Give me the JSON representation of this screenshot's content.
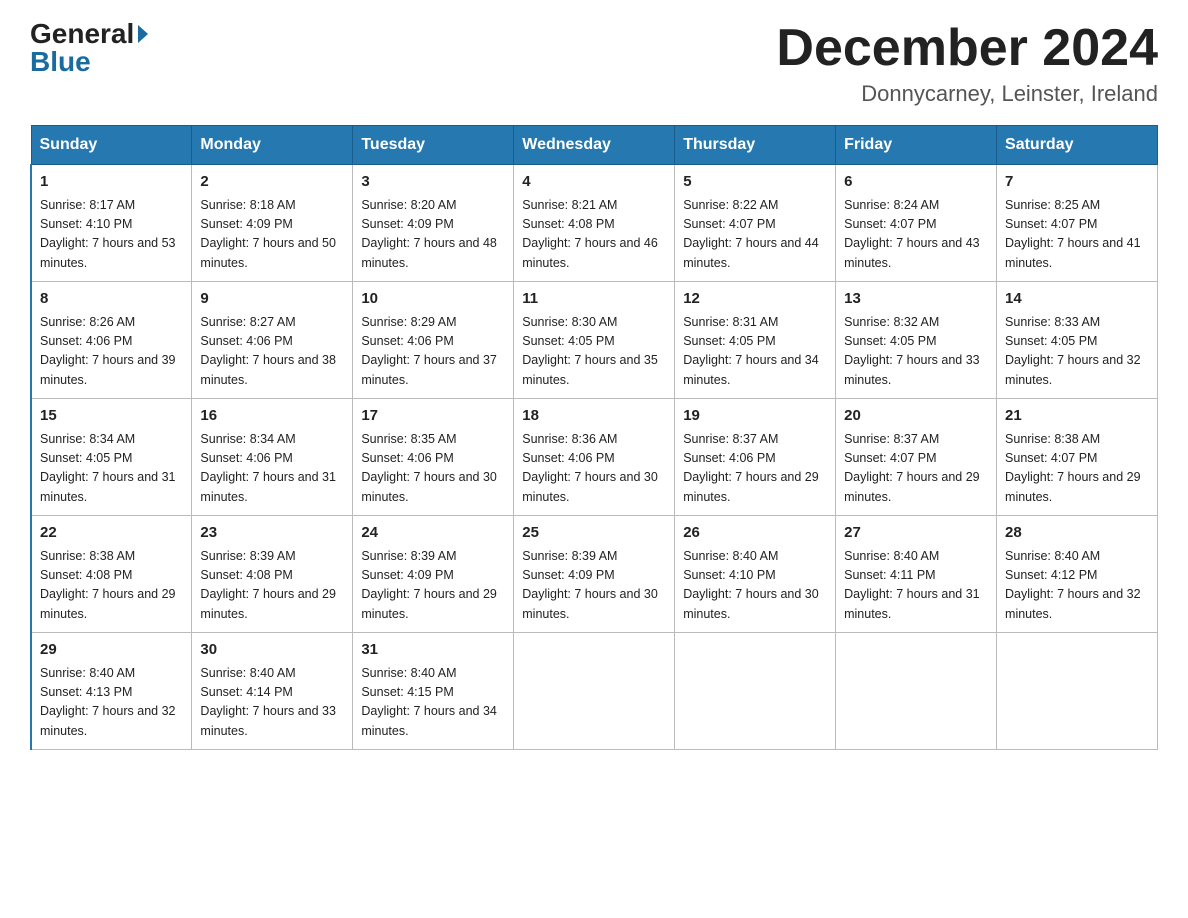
{
  "header": {
    "logo_general": "General",
    "logo_blue": "Blue",
    "month_title": "December 2024",
    "location": "Donnycarney, Leinster, Ireland"
  },
  "weekdays": [
    "Sunday",
    "Monday",
    "Tuesday",
    "Wednesday",
    "Thursday",
    "Friday",
    "Saturday"
  ],
  "weeks": [
    [
      {
        "day": "1",
        "sunrise": "8:17 AM",
        "sunset": "4:10 PM",
        "daylight": "7 hours and 53 minutes."
      },
      {
        "day": "2",
        "sunrise": "8:18 AM",
        "sunset": "4:09 PM",
        "daylight": "7 hours and 50 minutes."
      },
      {
        "day": "3",
        "sunrise": "8:20 AM",
        "sunset": "4:09 PM",
        "daylight": "7 hours and 48 minutes."
      },
      {
        "day": "4",
        "sunrise": "8:21 AM",
        "sunset": "4:08 PM",
        "daylight": "7 hours and 46 minutes."
      },
      {
        "day": "5",
        "sunrise": "8:22 AM",
        "sunset": "4:07 PM",
        "daylight": "7 hours and 44 minutes."
      },
      {
        "day": "6",
        "sunrise": "8:24 AM",
        "sunset": "4:07 PM",
        "daylight": "7 hours and 43 minutes."
      },
      {
        "day": "7",
        "sunrise": "8:25 AM",
        "sunset": "4:07 PM",
        "daylight": "7 hours and 41 minutes."
      }
    ],
    [
      {
        "day": "8",
        "sunrise": "8:26 AM",
        "sunset": "4:06 PM",
        "daylight": "7 hours and 39 minutes."
      },
      {
        "day": "9",
        "sunrise": "8:27 AM",
        "sunset": "4:06 PM",
        "daylight": "7 hours and 38 minutes."
      },
      {
        "day": "10",
        "sunrise": "8:29 AM",
        "sunset": "4:06 PM",
        "daylight": "7 hours and 37 minutes."
      },
      {
        "day": "11",
        "sunrise": "8:30 AM",
        "sunset": "4:05 PM",
        "daylight": "7 hours and 35 minutes."
      },
      {
        "day": "12",
        "sunrise": "8:31 AM",
        "sunset": "4:05 PM",
        "daylight": "7 hours and 34 minutes."
      },
      {
        "day": "13",
        "sunrise": "8:32 AM",
        "sunset": "4:05 PM",
        "daylight": "7 hours and 33 minutes."
      },
      {
        "day": "14",
        "sunrise": "8:33 AM",
        "sunset": "4:05 PM",
        "daylight": "7 hours and 32 minutes."
      }
    ],
    [
      {
        "day": "15",
        "sunrise": "8:34 AM",
        "sunset": "4:05 PM",
        "daylight": "7 hours and 31 minutes."
      },
      {
        "day": "16",
        "sunrise": "8:34 AM",
        "sunset": "4:06 PM",
        "daylight": "7 hours and 31 minutes."
      },
      {
        "day": "17",
        "sunrise": "8:35 AM",
        "sunset": "4:06 PM",
        "daylight": "7 hours and 30 minutes."
      },
      {
        "day": "18",
        "sunrise": "8:36 AM",
        "sunset": "4:06 PM",
        "daylight": "7 hours and 30 minutes."
      },
      {
        "day": "19",
        "sunrise": "8:37 AM",
        "sunset": "4:06 PM",
        "daylight": "7 hours and 29 minutes."
      },
      {
        "day": "20",
        "sunrise": "8:37 AM",
        "sunset": "4:07 PM",
        "daylight": "7 hours and 29 minutes."
      },
      {
        "day": "21",
        "sunrise": "8:38 AM",
        "sunset": "4:07 PM",
        "daylight": "7 hours and 29 minutes."
      }
    ],
    [
      {
        "day": "22",
        "sunrise": "8:38 AM",
        "sunset": "4:08 PM",
        "daylight": "7 hours and 29 minutes."
      },
      {
        "day": "23",
        "sunrise": "8:39 AM",
        "sunset": "4:08 PM",
        "daylight": "7 hours and 29 minutes."
      },
      {
        "day": "24",
        "sunrise": "8:39 AM",
        "sunset": "4:09 PM",
        "daylight": "7 hours and 29 minutes."
      },
      {
        "day": "25",
        "sunrise": "8:39 AM",
        "sunset": "4:09 PM",
        "daylight": "7 hours and 30 minutes."
      },
      {
        "day": "26",
        "sunrise": "8:40 AM",
        "sunset": "4:10 PM",
        "daylight": "7 hours and 30 minutes."
      },
      {
        "day": "27",
        "sunrise": "8:40 AM",
        "sunset": "4:11 PM",
        "daylight": "7 hours and 31 minutes."
      },
      {
        "day": "28",
        "sunrise": "8:40 AM",
        "sunset": "4:12 PM",
        "daylight": "7 hours and 32 minutes."
      }
    ],
    [
      {
        "day": "29",
        "sunrise": "8:40 AM",
        "sunset": "4:13 PM",
        "daylight": "7 hours and 32 minutes."
      },
      {
        "day": "30",
        "sunrise": "8:40 AM",
        "sunset": "4:14 PM",
        "daylight": "7 hours and 33 minutes."
      },
      {
        "day": "31",
        "sunrise": "8:40 AM",
        "sunset": "4:15 PM",
        "daylight": "7 hours and 34 minutes."
      },
      null,
      null,
      null,
      null
    ]
  ]
}
